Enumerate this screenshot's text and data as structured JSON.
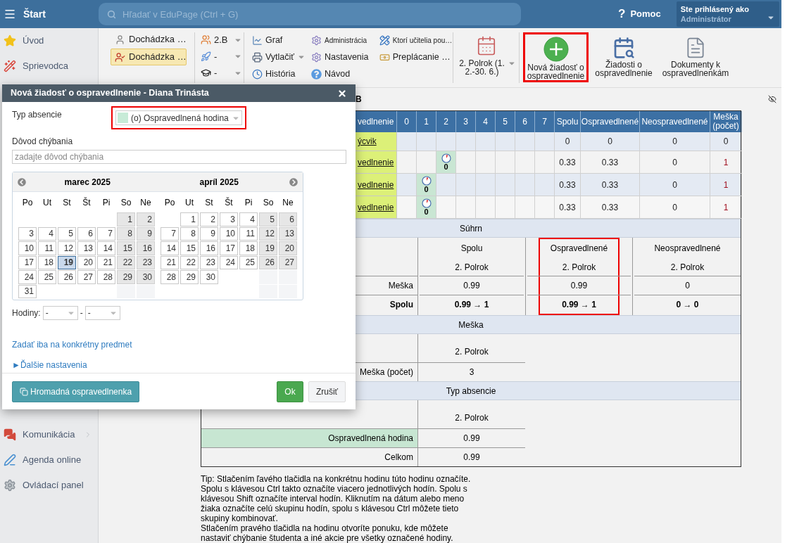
{
  "topbar": {
    "menu_label": "Štart",
    "search_placeholder": "Hľadať v EduPage (Ctrl + G)",
    "help_glyph": "?",
    "help_label": "Pomoc",
    "user_caption": "Ste prihlásený ako",
    "user_name": "Administrátor"
  },
  "sidebar": {
    "items": [
      {
        "label": "Úvod",
        "chevron": false
      },
      {
        "label": "Sprievodca",
        "chevron": false
      }
    ],
    "lower_items": [
      {
        "label": "Komunikácia",
        "chevron": true
      },
      {
        "label": "Agenda online",
        "chevron": false
      },
      {
        "label": "Ovládací panel",
        "chevron": false
      }
    ]
  },
  "toolbar": {
    "views": [
      {
        "label": "Dochádzka …",
        "selected": false
      },
      {
        "label": "Dochádzka …",
        "selected": true
      }
    ],
    "filters": [
      "2.B",
      "-",
      "-"
    ],
    "action_columns": [
      [
        {
          "label": "Graf",
          "small": false,
          "caret": false
        },
        {
          "label": "Vytlačiť",
          "small": false,
          "caret": true
        },
        {
          "label": "História",
          "small": false,
          "caret": false
        }
      ],
      [
        {
          "label": "Administrácia",
          "small": true,
          "caret": false
        },
        {
          "label": "Nastavenia",
          "small": false,
          "caret": false
        },
        {
          "label": "Návod",
          "small": false,
          "caret": false
        }
      ],
      [
        {
          "label": "Ktorí učitelia pou…",
          "small": true,
          "caret": false
        },
        {
          "label": "Preplácanie …",
          "small": false,
          "caret": false
        }
      ]
    ],
    "period": "2. Polrok (1. 2.-30. 6.)",
    "big_buttons": [
      {
        "label": "Nová žiadosť o ospravedlnenie",
        "highlighted": true
      },
      {
        "label": "Žiadosti o ospravedlnenie",
        "highlighted": false
      },
      {
        "label": "Dokumenty k ospravedlnenkám",
        "highlighted": false
      }
    ]
  },
  "heading": "B",
  "table": {
    "columns": [
      "vedlnenie",
      "0",
      "1",
      "2",
      "3",
      "4",
      "5",
      "6",
      "7",
      "Spolu",
      "Ospravedlnené",
      "Neospravedlnené",
      "Meška (počet)"
    ],
    "rows": [
      {
        "name": "ýcvik",
        "hours": [
          {
            "absent": false
          },
          {
            "absent": false
          },
          {
            "absent": false
          },
          {
            "absent": false
          },
          {
            "absent": false
          },
          {
            "absent": false
          },
          {
            "absent": false
          },
          {
            "absent": false
          }
        ],
        "totals": [
          "0",
          "0",
          "0",
          "0"
        ]
      },
      {
        "name": "vedlnenie",
        "hours": [
          {
            "absent": false
          },
          {
            "absent": false
          },
          {
            "absent": true,
            "value": "0"
          },
          {
            "absent": false
          },
          {
            "absent": false
          },
          {
            "absent": false
          },
          {
            "absent": false
          },
          {
            "absent": false
          }
        ],
        "totals": [
          "0.33",
          "0.33",
          "0",
          "1"
        ]
      },
      {
        "name": "vedlnenie",
        "hours": [
          {
            "absent": false
          },
          {
            "absent": true,
            "value": "0"
          },
          {
            "absent": false
          },
          {
            "absent": false
          },
          {
            "absent": false
          },
          {
            "absent": false
          },
          {
            "absent": false
          },
          {
            "absent": false
          }
        ],
        "totals": [
          "0.33",
          "0.33",
          "0",
          "1"
        ]
      },
      {
        "name": "vedlnenie",
        "hours": [
          {
            "absent": false
          },
          {
            "absent": true,
            "value": "0"
          },
          {
            "absent": false
          },
          {
            "absent": false
          },
          {
            "absent": false
          },
          {
            "absent": false
          },
          {
            "absent": false
          },
          {
            "absent": false
          }
        ],
        "totals": [
          "0.33",
          "0.33",
          "0",
          "1"
        ]
      }
    ]
  },
  "summary": {
    "title": "Súhrn",
    "row_labels": [
      {
        "label": "Meška",
        "bold": false
      },
      {
        "label": "Spolu",
        "bold": true
      }
    ],
    "columns": [
      {
        "heading": "Spolu",
        "period": "2. Polrok",
        "highlighted": false,
        "values": [
          "0.99",
          "0.99 → 1"
        ]
      },
      {
        "heading": "Ospravedlnené",
        "period": "2. Polrok",
        "highlighted": true,
        "values": [
          "0.99",
          "0.99 → 1"
        ]
      },
      {
        "heading": "Neospravedlnené",
        "period": "2. Polrok",
        "highlighted": false,
        "values": [
          "0",
          "0 → 0"
        ]
      }
    ]
  },
  "late": {
    "title": "Meška",
    "period": "2. Polrok",
    "rows": [
      {
        "label": "Meška (počet)",
        "value": "3"
      }
    ]
  },
  "absence_types": {
    "title": "Typ absencie",
    "period": "2. Polrok",
    "rows": [
      {
        "kind": "type",
        "label": "Ospravedlnená hodina",
        "value": "0.99",
        "color": "#c7e6d2"
      },
      {
        "kind": "total",
        "label": "Celkom",
        "value": "0.99"
      }
    ]
  },
  "tip": [
    "Tip: Stlačením ľavého tlačidla na konkrétnu hodinu túto hodinu označíte. Spolu s klávesou Ctrl takto označíte viacero jednotlivých hodín. Spolu s klávesou Shift označíte interval hodín. Kliknutím na dátum alebo meno žiaka označíte celú skupinu hodín, spolu s klávesou Ctrl môžete tieto skupiny kombinovať.",
    "Stlačením pravého tlačidla na hodinu otvoríte ponuku, kde môžete nastaviť chýbanie študenta a iné akcie pre všetky označené hodiny."
  ],
  "dialog": {
    "title": "Nová žiadosť o ospravedlnenie - Diana Trinásta",
    "type_label": "Typ absencie",
    "type_value": "(o) Ospravedlnená hodina",
    "type_highlighted": true,
    "reason_label": "Dôvod chýbania",
    "reason_placeholder": "zadajte dôvod chýbania",
    "months": [
      {
        "title": "marec 2025",
        "weekdays": [
          "Po",
          "Ut",
          "St",
          "Št",
          "Pi",
          "So",
          "Ne"
        ],
        "days": [
          {
            "kind": "blank"
          },
          {
            "kind": "blank"
          },
          {
            "kind": "blank"
          },
          {
            "kind": "blank"
          },
          {
            "kind": "blank"
          },
          {
            "kind": "day",
            "day": "1",
            "selected": false
          },
          {
            "kind": "day",
            "day": "2",
            "selected": false
          },
          {
            "kind": "day",
            "day": "3",
            "selected": false
          },
          {
            "kind": "day",
            "day": "4",
            "selected": false
          },
          {
            "kind": "day",
            "day": "5",
            "selected": false
          },
          {
            "kind": "day",
            "day": "6",
            "selected": false
          },
          {
            "kind": "day",
            "day": "7",
            "selected": false
          },
          {
            "kind": "day",
            "day": "8",
            "selected": false
          },
          {
            "kind": "day",
            "day": "9",
            "selected": false
          },
          {
            "kind": "day",
            "day": "10",
            "selected": false
          },
          {
            "kind": "day",
            "day": "11",
            "selected": false
          },
          {
            "kind": "day",
            "day": "12",
            "selected": false
          },
          {
            "kind": "day",
            "day": "13",
            "selected": false
          },
          {
            "kind": "day",
            "day": "14",
            "selected": false
          },
          {
            "kind": "day",
            "day": "15",
            "selected": false
          },
          {
            "kind": "day",
            "day": "16",
            "selected": false
          },
          {
            "kind": "day",
            "day": "17",
            "selected": false
          },
          {
            "kind": "day",
            "day": "18",
            "selected": false
          },
          {
            "kind": "day",
            "day": "19",
            "selected": true
          },
          {
            "kind": "day",
            "day": "20",
            "selected": false
          },
          {
            "kind": "day",
            "day": "21",
            "selected": false
          },
          {
            "kind": "day",
            "day": "22",
            "selected": false
          },
          {
            "kind": "day",
            "day": "23",
            "selected": false
          },
          {
            "kind": "day",
            "day": "24",
            "selected": false
          },
          {
            "kind": "day",
            "day": "25",
            "selected": false
          },
          {
            "kind": "day",
            "day": "26",
            "selected": false
          },
          {
            "kind": "day",
            "day": "27",
            "selected": false
          },
          {
            "kind": "day",
            "day": "28",
            "selected": false
          },
          {
            "kind": "day",
            "day": "29",
            "selected": false
          },
          {
            "kind": "day",
            "day": "30",
            "selected": false
          },
          {
            "kind": "day",
            "day": "31",
            "selected": false
          }
        ]
      },
      {
        "title": "apríl 2025",
        "weekdays": [
          "Po",
          "Ut",
          "St",
          "Št",
          "Pi",
          "So",
          "Ne"
        ],
        "days": [
          {
            "kind": "blank"
          },
          {
            "kind": "day",
            "day": "1",
            "selected": false
          },
          {
            "kind": "day",
            "day": "2",
            "selected": false
          },
          {
            "kind": "day",
            "day": "3",
            "selected": false
          },
          {
            "kind": "day",
            "day": "4",
            "selected": false
          },
          {
            "kind": "day",
            "day": "5",
            "selected": false
          },
          {
            "kind": "day",
            "day": "6",
            "selected": false
          },
          {
            "kind": "day",
            "day": "7",
            "selected": false
          },
          {
            "kind": "day",
            "day": "8",
            "selected": false
          },
          {
            "kind": "day",
            "day": "9",
            "selected": false
          },
          {
            "kind": "day",
            "day": "10",
            "selected": false
          },
          {
            "kind": "day",
            "day": "11",
            "selected": false
          },
          {
            "kind": "day",
            "day": "12",
            "selected": false
          },
          {
            "kind": "day",
            "day": "13",
            "selected": false
          },
          {
            "kind": "day",
            "day": "14",
            "selected": false
          },
          {
            "kind": "day",
            "day": "15",
            "selected": false
          },
          {
            "kind": "day",
            "day": "16",
            "selected": false
          },
          {
            "kind": "day",
            "day": "17",
            "selected": false
          },
          {
            "kind": "day",
            "day": "18",
            "selected": false
          },
          {
            "kind": "day",
            "day": "19",
            "selected": false
          },
          {
            "kind": "day",
            "day": "20",
            "selected": false
          },
          {
            "kind": "day",
            "day": "21",
            "selected": false
          },
          {
            "kind": "day",
            "day": "22",
            "selected": false
          },
          {
            "kind": "day",
            "day": "23",
            "selected": false
          },
          {
            "kind": "day",
            "day": "24",
            "selected": false
          },
          {
            "kind": "day",
            "day": "25",
            "selected": false
          },
          {
            "kind": "day",
            "day": "26",
            "selected": false
          },
          {
            "kind": "day",
            "day": "27",
            "selected": false
          },
          {
            "kind": "day",
            "day": "28",
            "selected": false
          },
          {
            "kind": "day",
            "day": "29",
            "selected": false
          },
          {
            "kind": "day",
            "day": "30",
            "selected": false
          }
        ]
      }
    ],
    "hours_label": "Hodiny:",
    "hours_from": "-",
    "hours_separator": "-",
    "hours_to": "-",
    "links": [
      "Zadať iba na konkrétny predmet",
      "►Ďalšie nastavenia"
    ],
    "bulk_button": "Hromadná ospravedlnenka",
    "ok_button": "Ok",
    "cancel_button": "Zrušiť"
  }
}
